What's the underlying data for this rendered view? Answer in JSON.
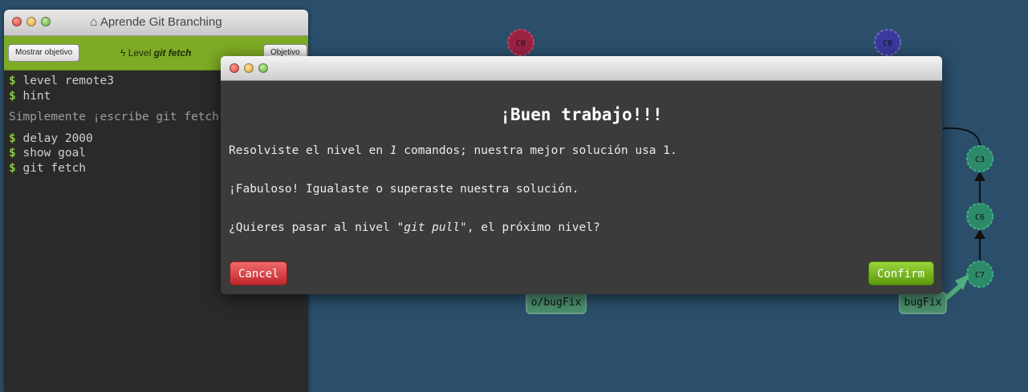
{
  "terminal": {
    "title": "Aprende Git Branching",
    "show_goal_label": "Mostrar objetivo",
    "level_prefix": "Level",
    "level_name": "git fetch",
    "objective_label": "Objetivo",
    "lines": [
      {
        "type": "cmd",
        "prompt": "$",
        "text": "level remote3"
      },
      {
        "type": "cmd",
        "prompt": "$",
        "text": "hint"
      },
      {
        "type": "msg",
        "text": "Simplemente ¡escribe git fetch!"
      },
      {
        "type": "cmd",
        "prompt": "$",
        "text": "delay 2000"
      },
      {
        "type": "cmd",
        "prompt": "$",
        "text": "show goal"
      },
      {
        "type": "cmd",
        "prompt": "$",
        "text": "git fetch"
      }
    ]
  },
  "graph": {
    "commits_local": [
      "C0"
    ],
    "commits_remote": [
      "C0",
      "C3",
      "C6",
      "C7"
    ],
    "branches": [
      "o/bugFix",
      "bugFix"
    ],
    "colors": {
      "background": "#2b4f6b",
      "local_root": "#9b2243",
      "remote_root": "#3a3a9c",
      "commit": "#2d8a68",
      "branch": "#4a8f6e"
    }
  },
  "modal": {
    "heading": "¡Buen trabajo!!!",
    "line1_pre": "Resolviste el nivel en ",
    "line1_count": "1",
    "line1_post": " comandos; nuestra mejor solución usa 1.",
    "line2": "¡Fabuloso! Igualaste o superaste nuestra solución.",
    "line3_pre": "¿Quieres pasar al nivel ",
    "line3_level": "\"git pull\"",
    "line3_post": ", el próximo nivel?",
    "cancel_label": "Cancel",
    "confirm_label": "Confirm"
  }
}
